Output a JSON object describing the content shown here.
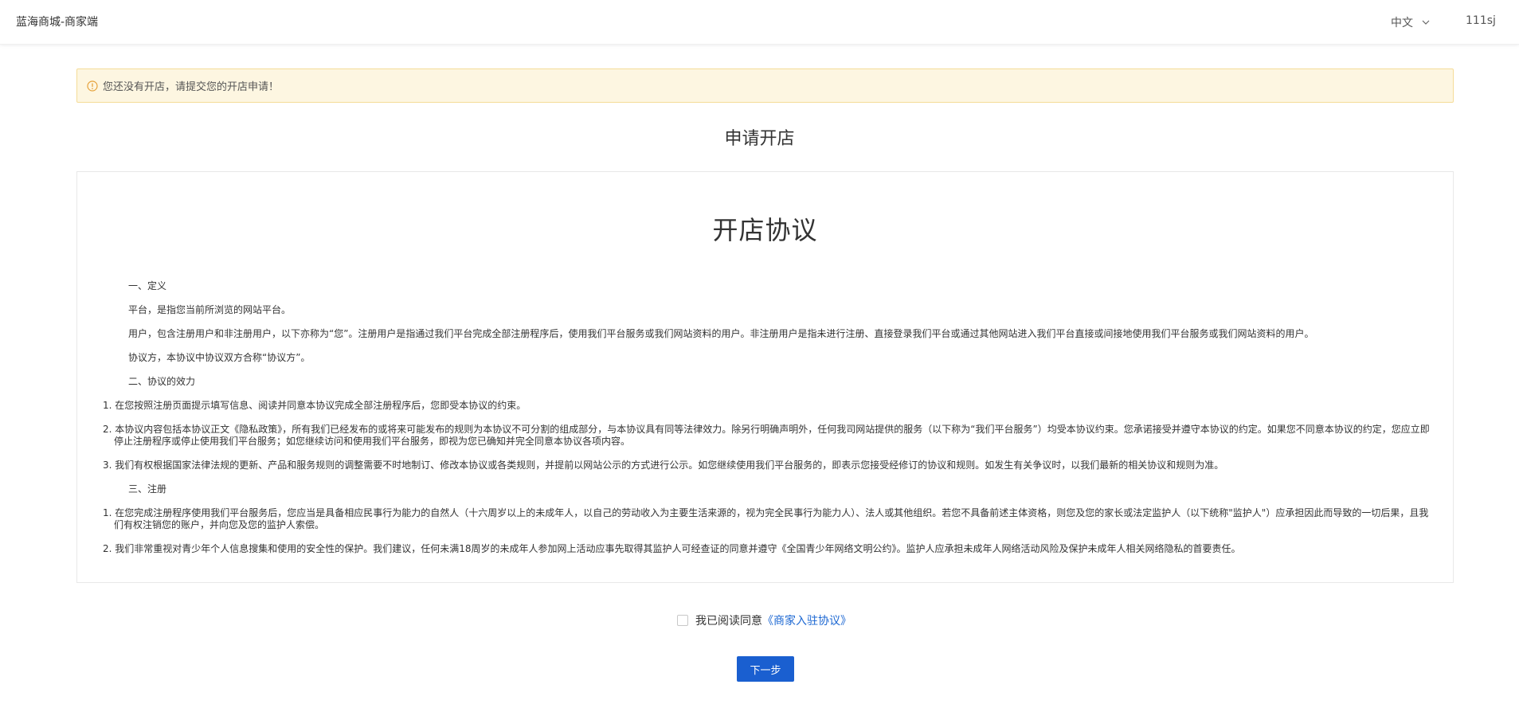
{
  "header": {
    "brand": "蓝海商城-商家端",
    "language": "中文",
    "username": "111sj"
  },
  "alert": {
    "message": "您还没有开店，请提交您的开店申请！"
  },
  "page_title": "申请开店",
  "agreement": {
    "title": "开店协议",
    "paragraphs": [
      {
        "style": "indent",
        "text": "一、定义"
      },
      {
        "style": "indent",
        "text": "平台，是指您当前所浏览的网站平台。"
      },
      {
        "style": "indent",
        "text": "用户，包含注册用户和非注册用户，以下亦称为“您”。注册用户是指通过我们平台完成全部注册程序后，使用我们平台服务或我们网站资料的用户。非注册用户是指未进行注册、直接登录我们平台或通过其他网站进入我们平台直接或间接地使用我们平台服务或我们网站资料的用户。"
      },
      {
        "style": "indent",
        "text": "协议方，本协议中协议双方合称“协议方”。"
      },
      {
        "style": "indent",
        "text": "二、协议的效力"
      },
      {
        "style": "num",
        "text": "1. 在您按照注册页面提示填写信息、阅读并同意本协议完成全部注册程序后，您即受本协议的约束。"
      },
      {
        "style": "num",
        "text": "2. 本协议内容包括本协议正文《隐私政策》，所有我们已经发布的或将来可能发布的规则为本协议不可分割的组成部分，与本协议具有同等法律效力。除另行明确声明外，任何我司网站提供的服务（以下称为“我们平台服务”）均受本协议约束。您承诺接受并遵守本协议的约定。如果您不同意本协议的约定，您应立即停止注册程序或停止使用我们平台服务；如您继续访问和使用我们平台服务，即视为您已确知并完全同意本协议各项内容。"
      },
      {
        "style": "num",
        "text": "3. 我们有权根据国家法律法规的更新、产品和服务规则的调整需要不时地制订、修改本协议或各类规则，并提前以网站公示的方式进行公示。如您继续使用我们平台服务的，即表示您接受经修订的协议和规则。如发生有关争议时，以我们最新的相关协议和规则为准。"
      },
      {
        "style": "indent",
        "text": "三、注册"
      },
      {
        "style": "num",
        "text": "1. 在您完成注册程序使用我们平台服务后，您应当是具备相应民事行为能力的自然人（十六周岁以上的未成年人，以自己的劳动收入为主要生活来源的，视为完全民事行为能力人）、法人或其他组织。若您不具备前述主体资格，则您及您的家长或法定监护人（以下统称\"监护人\"）应承担因此而导致的一切后果，且我们有权注销您的账户，并向您及您的监护人索偿。"
      },
      {
        "style": "num",
        "text": "2. 我们非常重视对青少年个人信息搜集和使用的安全性的保护。我们建议，任何未满18周岁的未成年人参加网上活动应事先取得其监护人可经查证的同意并遵守《全国青少年网络文明公约》。监护人应承担未成年人网络活动风险及保护未成年人相关网络隐私的首要责任。"
      }
    ]
  },
  "consent": {
    "prefix": "我已阅读同意",
    "link": "《商家入驻协议》"
  },
  "next_button": "下一步",
  "colors": {
    "primary": "#1a5fd0",
    "link": "#1a66d2",
    "alert_bg": "#fdf6e1",
    "alert_border": "#f5dc98",
    "warn_icon": "#e6a23c"
  }
}
